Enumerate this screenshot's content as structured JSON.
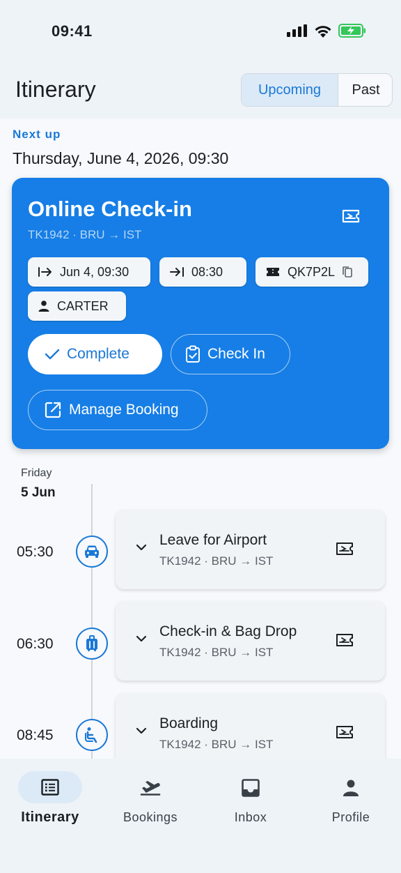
{
  "status_bar": {
    "time": "09:41"
  },
  "header": {
    "title": "Itinerary",
    "tabs": [
      "Upcoming",
      "Past"
    ],
    "selected_tab": "Upcoming"
  },
  "next_up": {
    "label": "Next up",
    "datetime": "Thursday, June 4, 2026, 09:30",
    "card": {
      "title": "Online Check-in",
      "subtitle": "TK1942 · BRU → IST",
      "chips": {
        "checkin_time": "Jun 4, 09:30",
        "boarding_time": "08:30",
        "pnr": "QK7P2L",
        "passenger": "CARTER"
      },
      "buttons": {
        "complete": "Complete",
        "check_in": "Check In",
        "manage_booking": "Manage Booking"
      }
    }
  },
  "timeline": {
    "weekday": "Friday",
    "date": "5 Jun",
    "events": [
      {
        "time": "05:30",
        "title": "Leave for Airport",
        "subtitle": "TK1942 · BRU → IST",
        "icon": "car-icon"
      },
      {
        "time": "06:30",
        "title": "Check-in & Bag Drop",
        "subtitle": "TK1942 · BRU → IST",
        "icon": "luggage-icon"
      },
      {
        "time": "08:45",
        "title": "Boarding",
        "subtitle": "TK1942 · BRU → IST",
        "icon": "boarding-icon"
      }
    ]
  },
  "bottom_nav": {
    "items": [
      {
        "label": "Itinerary",
        "icon": "list-icon",
        "active": true
      },
      {
        "label": "Bookings",
        "icon": "flight-takeoff-icon",
        "active": false
      },
      {
        "label": "Inbox",
        "icon": "inbox-icon",
        "active": false
      },
      {
        "label": "Profile",
        "icon": "person-icon",
        "active": false
      }
    ]
  },
  "colors": {
    "accent": "#1a78d6",
    "card_blue": "#167ee6",
    "selected_tab_bg": "#dceaf7",
    "battery_green": "#34c759"
  }
}
